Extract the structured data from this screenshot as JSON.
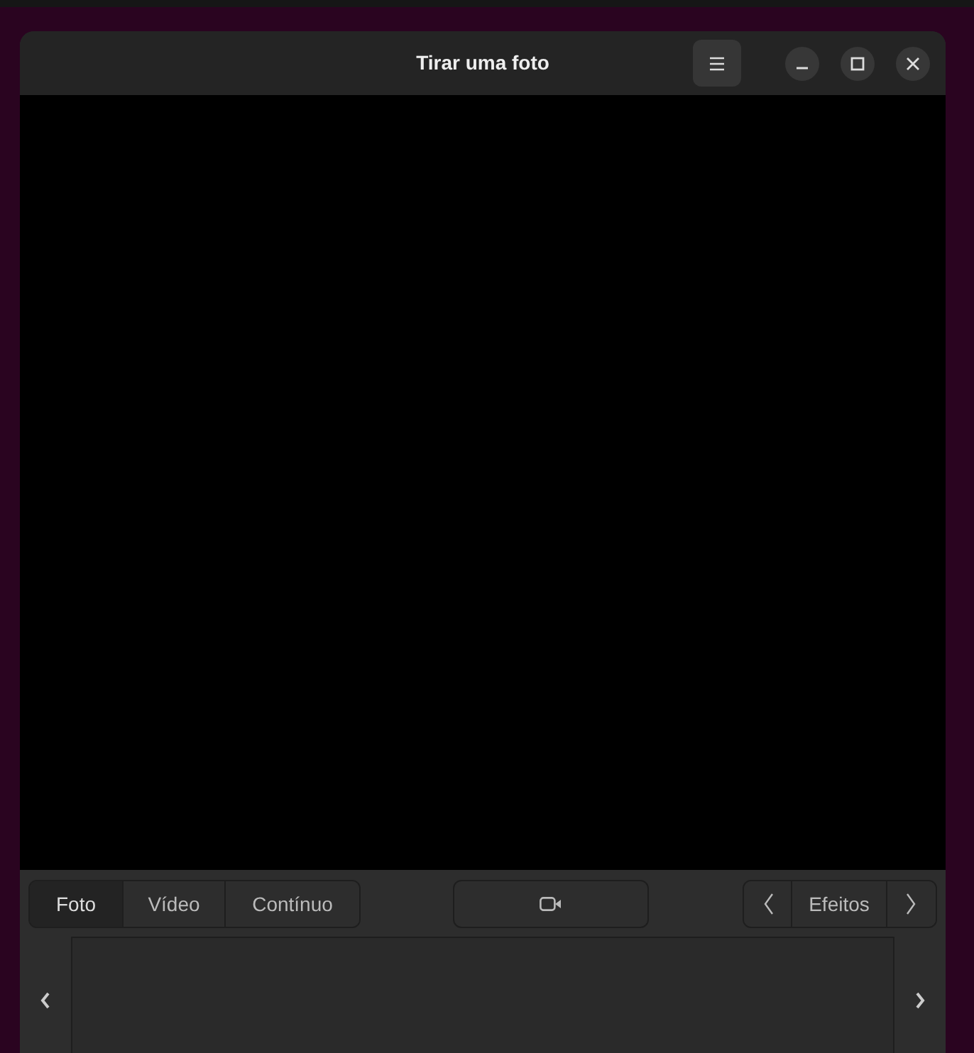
{
  "window": {
    "title": "Tirar uma foto"
  },
  "modes": [
    {
      "label": "Foto",
      "selected": true
    },
    {
      "label": "Vídeo",
      "selected": false
    },
    {
      "label": "Contínuo",
      "selected": false
    }
  ],
  "effects": {
    "label": "Efeitos"
  }
}
